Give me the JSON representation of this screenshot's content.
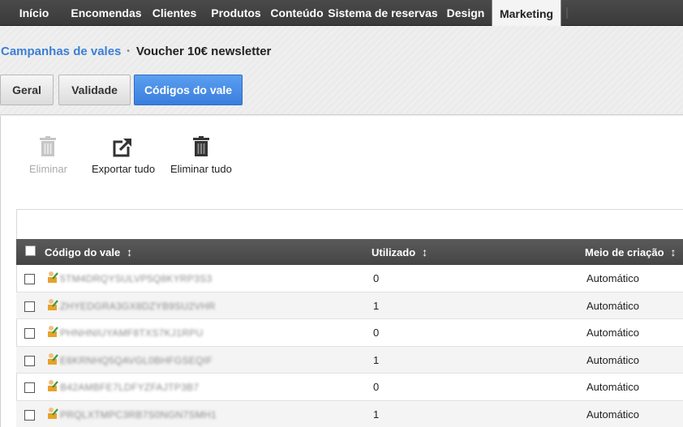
{
  "nav": {
    "items": [
      "Início",
      "Encomendas",
      "Clientes",
      "Produtos",
      "Conteúdo",
      "Sistema de reservas",
      "Design",
      "Marketing"
    ],
    "active_index": 7
  },
  "breadcrumb": {
    "parent": "Campanhas de vales",
    "separator": "•",
    "current": "Voucher 10€ newsletter"
  },
  "tabs": [
    {
      "label": "Geral"
    },
    {
      "label": "Validade"
    },
    {
      "label": "Códigos do vale",
      "active": true
    }
  ],
  "toolbar": {
    "delete_label": "Eliminar",
    "export_all_label": "Exportar tudo",
    "delete_all_label": "Eliminar tudo"
  },
  "table": {
    "headers": {
      "code": "Código do vale",
      "used": "Utilizado",
      "creation": "Meio de criação"
    },
    "rows": [
      {
        "code": "5TM4DRQYSULVP5Q8KYRP3S3",
        "used": "0",
        "creation": "Automático"
      },
      {
        "code": "ZHYEDGRA3GX8DZYB9SU2VHR",
        "used": "1",
        "creation": "Automático"
      },
      {
        "code": "PHNHNIUYAMF8TXS7KJ1RPU",
        "used": "0",
        "creation": "Automático"
      },
      {
        "code": "E6KRNHQ5QAVGL0BHFGSEQIF",
        "used": "1",
        "creation": "Automático"
      },
      {
        "code": "B42AMBFE7LDFYZFAJTP3B7",
        "used": "0",
        "creation": "Automático"
      },
      {
        "code": "PRQLXTMPC3RB7S0NGN7SMH1",
        "used": "1",
        "creation": "Automático"
      }
    ]
  },
  "colors": {
    "nav_bg": "#3f3f3f",
    "accent": "#3b7fd4",
    "tab_active": "#4a8ee6"
  }
}
